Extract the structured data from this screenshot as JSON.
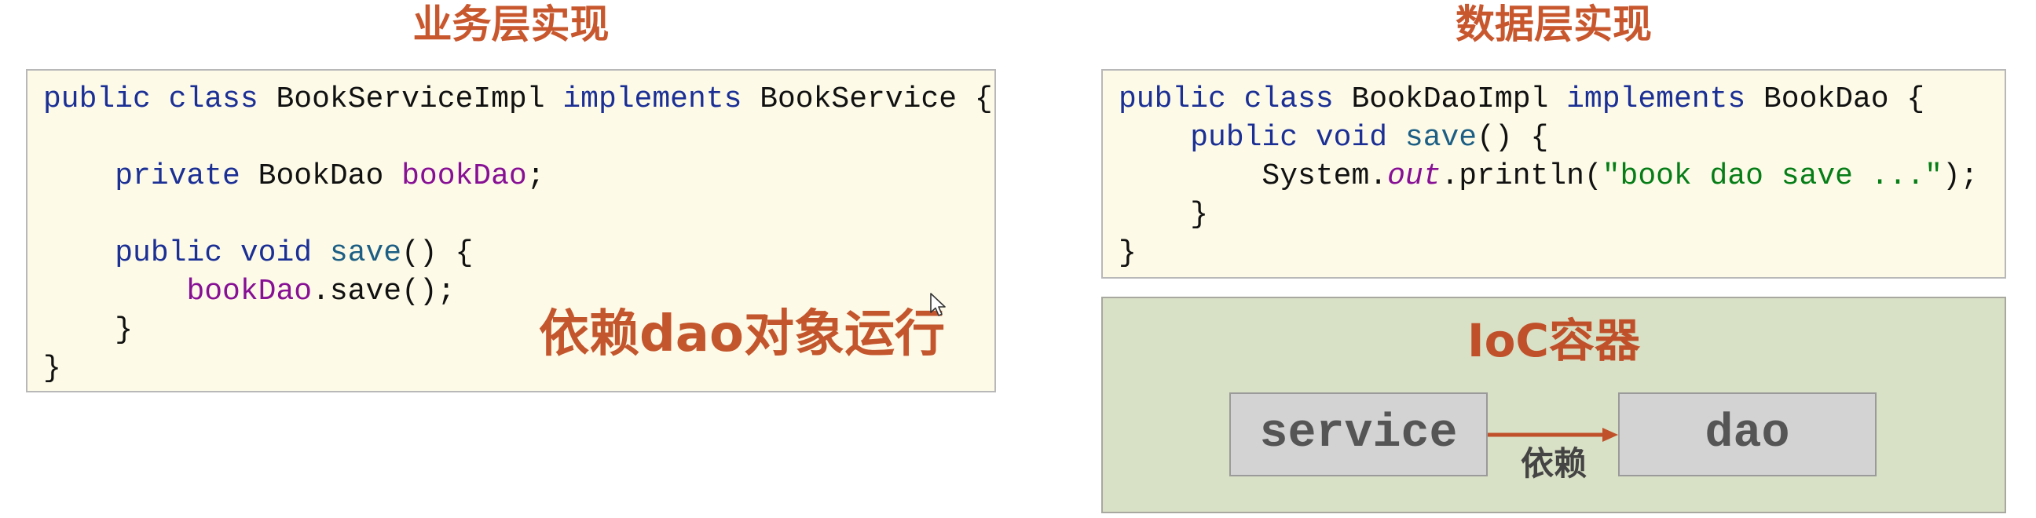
{
  "titles": {
    "business_layer": "业务层实现",
    "data_layer": "数据层实现"
  },
  "service_code": {
    "lines": [
      [
        {
          "type": "keyword",
          "text": "public"
        },
        {
          "type": "plain",
          "text": " "
        },
        {
          "type": "keyword",
          "text": "class"
        },
        {
          "type": "plain",
          "text": " BookServiceImpl "
        },
        {
          "type": "keyword",
          "text": "implements"
        },
        {
          "type": "plain",
          "text": " BookService {"
        }
      ],
      [],
      [
        {
          "type": "plain",
          "text": "    "
        },
        {
          "type": "keyword",
          "text": "private"
        },
        {
          "type": "plain",
          "text": " BookDao "
        },
        {
          "type": "field",
          "text": "bookDao"
        },
        {
          "type": "plain",
          "text": ";"
        }
      ],
      [],
      [
        {
          "type": "plain",
          "text": "    "
        },
        {
          "type": "keyword",
          "text": "public"
        },
        {
          "type": "plain",
          "text": " "
        },
        {
          "type": "keyword",
          "text": "void"
        },
        {
          "type": "plain",
          "text": " "
        },
        {
          "type": "method",
          "text": "save"
        },
        {
          "type": "plain",
          "text": "() {"
        }
      ],
      [
        {
          "type": "plain",
          "text": "        "
        },
        {
          "type": "field",
          "text": "bookDao"
        },
        {
          "type": "plain",
          "text": ".save();"
        }
      ],
      [
        {
          "type": "plain",
          "text": "    }"
        }
      ],
      [
        {
          "type": "plain",
          "text": "}"
        }
      ]
    ]
  },
  "dao_code": {
    "lines": [
      [
        {
          "type": "keyword",
          "text": "public"
        },
        {
          "type": "plain",
          "text": " "
        },
        {
          "type": "keyword",
          "text": "class"
        },
        {
          "type": "plain",
          "text": " BookDaoImpl "
        },
        {
          "type": "keyword",
          "text": "implements"
        },
        {
          "type": "plain",
          "text": " BookDao {"
        }
      ],
      [
        {
          "type": "plain",
          "text": "    "
        },
        {
          "type": "keyword",
          "text": "public"
        },
        {
          "type": "plain",
          "text": " "
        },
        {
          "type": "keyword",
          "text": "void"
        },
        {
          "type": "plain",
          "text": " "
        },
        {
          "type": "method",
          "text": "save"
        },
        {
          "type": "plain",
          "text": "() {"
        }
      ],
      [
        {
          "type": "plain",
          "text": "        System."
        },
        {
          "type": "static_field",
          "text": "out"
        },
        {
          "type": "plain",
          "text": ".println("
        },
        {
          "type": "string",
          "text": "\"book dao save ...\""
        },
        {
          "type": "plain",
          "text": ");"
        }
      ],
      [
        {
          "type": "plain",
          "text": "    }"
        }
      ],
      [
        {
          "type": "plain",
          "text": "}"
        }
      ]
    ]
  },
  "annotation": "依赖dao对象运行",
  "ioc_container": {
    "title": "IoC容器",
    "nodes": {
      "service": "service",
      "dao": "dao"
    },
    "dependency_label": "依赖"
  },
  "icons": {
    "cursor": "mouse-pointer-icon",
    "arrow": "right-arrow-icon"
  },
  "colors": {
    "title": "#c8572e",
    "annotation": "#c4562d",
    "accent": "#c0502a",
    "code_background": "#fdfbe8",
    "code_border": "#b8b8b8",
    "ioc_background": "#d8e0c5",
    "ioc_border": "#a8a8a0",
    "node_background": "#d3d3d3",
    "node_border": "#9a9a9a",
    "node_text": "#555555",
    "label_text": "#444444",
    "keyword": "#1b2f95",
    "method": "#1d5f84",
    "field": "#871094",
    "string": "#067d17",
    "plain_text": "#111111"
  }
}
